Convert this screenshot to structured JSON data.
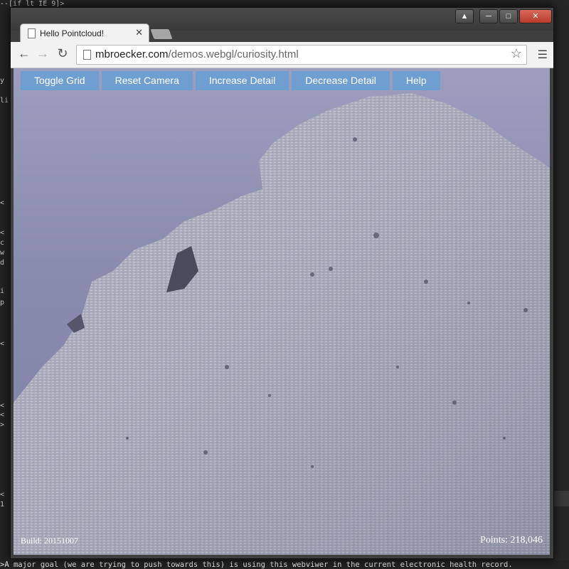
{
  "browser": {
    "tab_title": "Hello Pointcloud!",
    "url_host": "mbroecker.com",
    "url_path": "/demos.webgl/curiosity.html"
  },
  "app": {
    "buttons": [
      "Toggle Grid",
      "Reset Camera",
      "Increase Detail",
      "Decrease Detail",
      "Help"
    ],
    "build_label": "Build: 20151007",
    "points_label": "Points: 218,046"
  },
  "background_editor": {
    "bottom_line": ">A major goal (we are trying to push towards this) is using this webviwer in the current electronic health record."
  },
  "colors": {
    "button_bg": "#6f9ed0",
    "sky_top": "#9d9ebe",
    "sky_bottom": "#7e80a4",
    "rock": "#a4a6b8"
  }
}
